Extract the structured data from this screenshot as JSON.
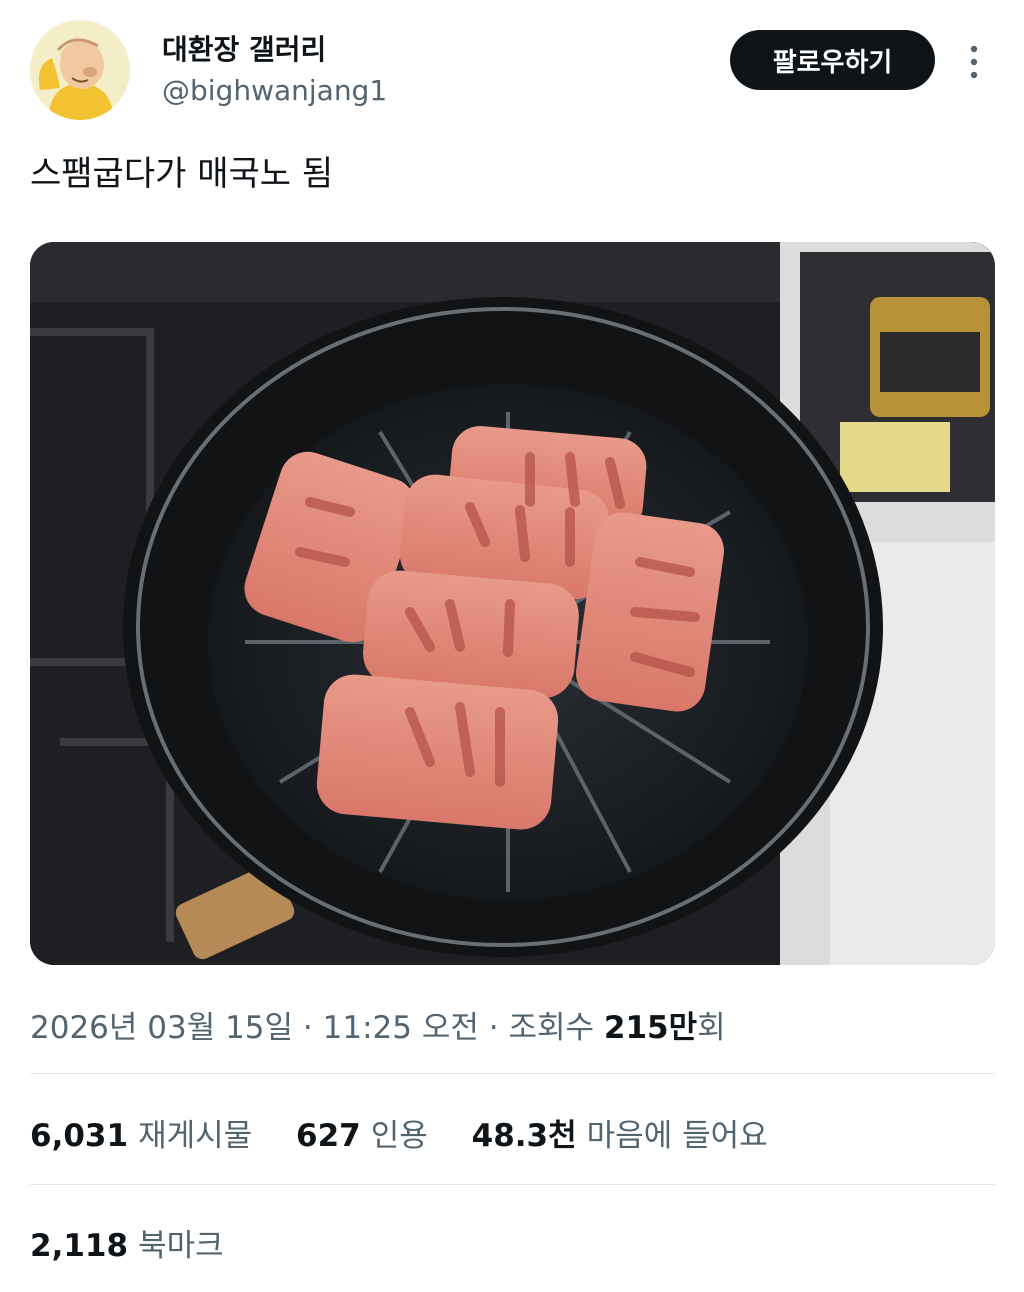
{
  "profile": {
    "display_name": "대환장 갤러리",
    "handle": "@bighwanjang1",
    "avatar_icon": "avatar-cartoon-person-icon"
  },
  "header": {
    "follow_label": "팔로우하기",
    "more_icon": "more-vertical-icon"
  },
  "tweet": {
    "text": "스팸굽다가 매국노 됨",
    "date": "2026년 03월 15일",
    "separator": "·",
    "time": "11:25 오전",
    "views_prefix": "조회수",
    "views_value": "215만",
    "views_suffix": "회"
  },
  "stats": {
    "retweets_value": "6,031",
    "retweets_label": "재게시물",
    "quotes_value": "627",
    "quotes_label": "인용",
    "likes_value": "48.3천",
    "likes_label": "마음에 들어요",
    "bookmarks_value": "2,118",
    "bookmarks_label": "북마크"
  },
  "colors": {
    "text_primary": "#0f1419",
    "text_secondary": "#536471",
    "button_bg": "#0f1419",
    "divider": "#e5e9ec"
  }
}
